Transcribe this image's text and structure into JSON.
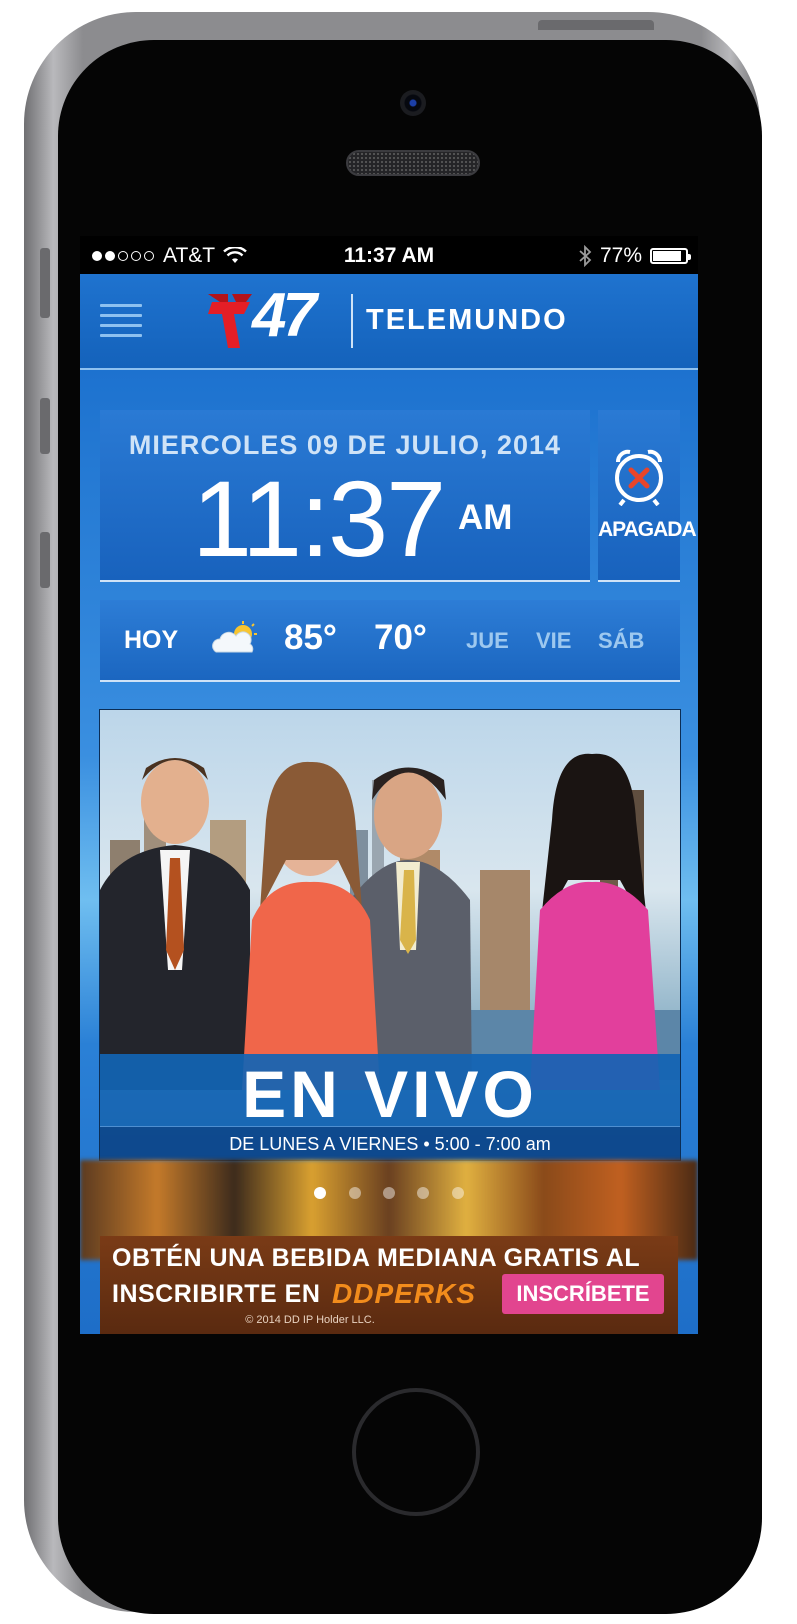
{
  "status_bar": {
    "carrier": "AT&T",
    "time": "11:37 AM",
    "battery": "77%",
    "battery_level": 0.77
  },
  "header": {
    "logo_number": "47",
    "brand": "TELEMUNDO"
  },
  "clock": {
    "date": "MIERCOLES  09 DE JULIO, 2014",
    "time": "11:37",
    "ampm": "AM"
  },
  "alarm": {
    "status": "APAGADA"
  },
  "weather": {
    "today": "HOY",
    "high": "85°",
    "low": "70°",
    "days": [
      "JUE",
      "VIE",
      "SÁB"
    ]
  },
  "promo": {
    "title": "EN VIVO",
    "schedule": "DE LUNES A VIERNES • 5:00 - 7:00 am",
    "page_count": 5,
    "active_page": 1
  },
  "ad": {
    "line1": "OBTÉN UNA BEBIDA MEDIANA GRATIS AL",
    "line2": "INSCRIBIRTE EN",
    "brand": "DDPERKS",
    "cta": "INSCRÍBETE",
    "legal": "© 2014 DD IP Holder LLC."
  },
  "colors": {
    "brand_blue": "#1565c0",
    "logo_red": "#e41e26",
    "ad_pink": "#e2458f",
    "ad_orange": "#f28c1c"
  }
}
